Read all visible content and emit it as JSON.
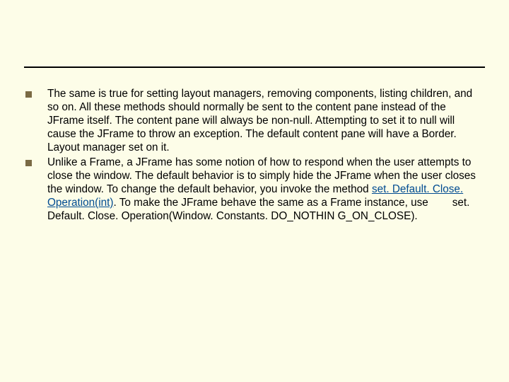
{
  "bullets": [
    {
      "text": "The same is true for setting layout managers, removing components, listing children, and so on. All these methods should normally be sent to the content pane instead of the JFrame itself. The content pane will always be non-null. Attempting to set it to null will cause the JFrame to throw an exception. The default content pane will have a Border. Layout manager set on it."
    },
    {
      "pre": "Unlike a Frame, a JFrame has some notion of how to respond when the user attempts to close the window. The default behavior is to simply hide the JFrame when the user closes the window. To change the default behavior, you invoke the method ",
      "link": "set. Default. Close. Operation(int)",
      "post": ". To make the JFrame behave the same as a Frame instance, use        set. Default. Close. Operation(Window. Constants. DO_NOTHIN G_ON_CLOSE)."
    }
  ]
}
